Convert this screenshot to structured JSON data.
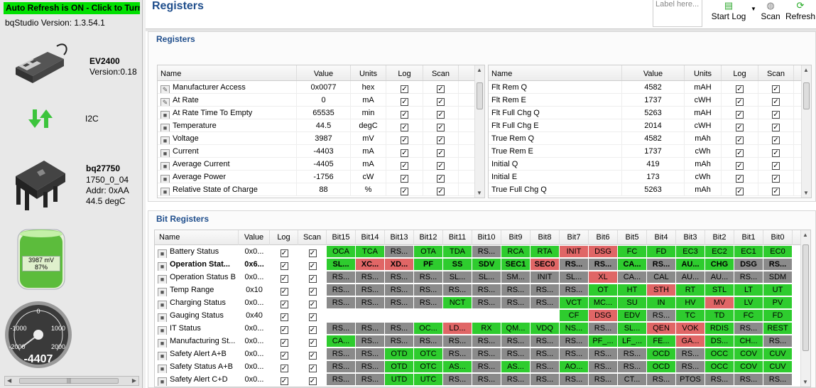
{
  "left_panel": {
    "refresh_banner": "Auto Refresh is ON - Click to Turn",
    "version": "bqStudio Version:  1.3.54.1",
    "adapter_name": "EV2400",
    "adapter_version": "Version:0.18",
    "bus": "I2C",
    "device_name": "bq27750",
    "device_fw": "1750_0_04",
    "device_addr": "Addr: 0xAA",
    "device_temp": "44.5 degC",
    "battery_mv": "3987 mV",
    "battery_pct": "87%",
    "battery_level": 0.87,
    "gauge_value": "-4407",
    "gauge_ticks": [
      "0",
      "-1000",
      "1000",
      "-2000",
      "2000"
    ]
  },
  "header": {
    "title": "Registers",
    "label_placeholder": "Label here...",
    "start_log": "Start Log",
    "scan": "Scan",
    "refresh": "Refresh"
  },
  "registers": {
    "title": "Registers",
    "columns": [
      "Name",
      "Value",
      "Units",
      "Log",
      "Scan"
    ],
    "left_rows": [
      {
        "name": "Manufacturer Access",
        "value": "0x0077",
        "units": "hex",
        "icon": "pencil"
      },
      {
        "name": "At Rate",
        "value": "0",
        "units": "mA",
        "icon": "pencil"
      },
      {
        "name": "At Rate Time To Empty",
        "value": "65535",
        "units": "min",
        "icon": "lock"
      },
      {
        "name": "Temperature",
        "value": "44.5",
        "units": "degC",
        "icon": "lock"
      },
      {
        "name": "Voltage",
        "value": "3987",
        "units": "mV",
        "icon": "lock"
      },
      {
        "name": "Current",
        "value": "-4403",
        "units": "mA",
        "icon": "lock"
      },
      {
        "name": "Average Current",
        "value": "-4405",
        "units": "mA",
        "icon": "lock"
      },
      {
        "name": "Average Power",
        "value": "-1756",
        "units": "cW",
        "icon": "lock"
      },
      {
        "name": "Relative State of Charge",
        "value": "88",
        "units": "%",
        "icon": "lock"
      }
    ],
    "right_rows": [
      {
        "name": "Flt Rem Q",
        "value": "4582",
        "units": "mAH"
      },
      {
        "name": "Flt Rem E",
        "value": "1737",
        "units": "cWH"
      },
      {
        "name": "Flt Full Chg Q",
        "value": "5263",
        "units": "mAH"
      },
      {
        "name": "Flt Full Chg E",
        "value": "2014",
        "units": "cWH"
      },
      {
        "name": "True Rem Q",
        "value": "4582",
        "units": "mAh"
      },
      {
        "name": "True Rem E",
        "value": "1737",
        "units": "cWh"
      },
      {
        "name": "Initial Q",
        "value": "419",
        "units": "mAh"
      },
      {
        "name": "Initial E",
        "value": "173",
        "units": "cWh"
      },
      {
        "name": "True Full Chg Q",
        "value": "5263",
        "units": "mAh"
      }
    ]
  },
  "bit_registers": {
    "title": "Bit Registers",
    "columns": [
      "Name",
      "Value",
      "Log",
      "Scan",
      "Bit15",
      "Bit14",
      "Bit13",
      "Bit12",
      "Bit11",
      "Bit10",
      "Bit9",
      "Bit8",
      "Bit7",
      "Bit6",
      "Bit5",
      "Bit4",
      "Bit3",
      "Bit2",
      "Bit1",
      "Bit0"
    ],
    "rows": [
      {
        "name": "Battery Status",
        "value": "0x0...",
        "bold": false,
        "bits": [
          [
            "OCA",
            "g"
          ],
          [
            "TCA",
            "g"
          ],
          [
            "RS...",
            "y"
          ],
          [
            "OTA",
            "g"
          ],
          [
            "TDA",
            "g"
          ],
          [
            "RS...",
            "y"
          ],
          [
            "RCA",
            "g"
          ],
          [
            "RTA",
            "g"
          ],
          [
            "INIT",
            "r"
          ],
          [
            "DSG",
            "r"
          ],
          [
            "FC",
            "g"
          ],
          [
            "FD",
            "g"
          ],
          [
            "EC3",
            "g"
          ],
          [
            "EC2",
            "g"
          ],
          [
            "EC1",
            "g"
          ],
          [
            "EC0",
            "g"
          ]
        ]
      },
      {
        "name": "Operation Stat...",
        "value": "0x6...",
        "bold": true,
        "bits": [
          [
            "SL...",
            "g"
          ],
          [
            "XC...",
            "r"
          ],
          [
            "XD...",
            "r"
          ],
          [
            "PF",
            "g"
          ],
          [
            "SS",
            "g"
          ],
          [
            "SDV",
            "g"
          ],
          [
            "SEC1",
            "g"
          ],
          [
            "SEC0",
            "r"
          ],
          [
            "RS...",
            "y"
          ],
          [
            "RS...",
            "y"
          ],
          [
            "CA...",
            "g"
          ],
          [
            "RS...",
            "y"
          ],
          [
            "AU...",
            "g"
          ],
          [
            "CHG",
            "g"
          ],
          [
            "DSG",
            "y"
          ],
          [
            "RS...",
            "y"
          ]
        ]
      },
      {
        "name": "Operation Status B",
        "value": "0x0...",
        "bold": false,
        "bits": [
          [
            "RS...",
            "y"
          ],
          [
            "RS...",
            "y"
          ],
          [
            "RS...",
            "y"
          ],
          [
            "RS...",
            "y"
          ],
          [
            "SL...",
            "y"
          ],
          [
            "SL...",
            "y"
          ],
          [
            "SM...",
            "y"
          ],
          [
            "INIT",
            "y"
          ],
          [
            "SL...",
            "y"
          ],
          [
            "XL",
            "r"
          ],
          [
            "CA...",
            "y"
          ],
          [
            "CAL",
            "y"
          ],
          [
            "AU...",
            "y"
          ],
          [
            "AU...",
            "y"
          ],
          [
            "RS...",
            "y"
          ],
          [
            "SDM",
            "y"
          ]
        ]
      },
      {
        "name": "Temp Range",
        "value": "0x10",
        "bold": false,
        "bits": [
          [
            "RS...",
            "y"
          ],
          [
            "RS...",
            "y"
          ],
          [
            "RS...",
            "y"
          ],
          [
            "RS...",
            "y"
          ],
          [
            "RS...",
            "y"
          ],
          [
            "RS...",
            "y"
          ],
          [
            "RS...",
            "y"
          ],
          [
            "RS...",
            "y"
          ],
          [
            "RS...",
            "y"
          ],
          [
            "OT",
            "g"
          ],
          [
            "HT",
            "g"
          ],
          [
            "STH",
            "r"
          ],
          [
            "RT",
            "g"
          ],
          [
            "STL",
            "g"
          ],
          [
            "LT",
            "g"
          ],
          [
            "UT",
            "g"
          ]
        ]
      },
      {
        "name": "Charging Status",
        "value": "0x0...",
        "bold": false,
        "bits": [
          [
            "RS...",
            "y"
          ],
          [
            "RS...",
            "y"
          ],
          [
            "RS...",
            "y"
          ],
          [
            "RS...",
            "y"
          ],
          [
            "NCT",
            "g"
          ],
          [
            "RS...",
            "y"
          ],
          [
            "RS...",
            "y"
          ],
          [
            "RS...",
            "y"
          ],
          [
            "VCT",
            "g"
          ],
          [
            "MC...",
            "g"
          ],
          [
            "SU",
            "g"
          ],
          [
            "IN",
            "g"
          ],
          [
            "HV",
            "g"
          ],
          [
            "MV",
            "r"
          ],
          [
            "LV",
            "g"
          ],
          [
            "PV",
            "g"
          ]
        ]
      },
      {
        "name": "Gauging Status",
        "value": "0x40",
        "bold": false,
        "bits": [
          [
            "",
            ""
          ],
          [
            "",
            ""
          ],
          [
            "",
            ""
          ],
          [
            "",
            ""
          ],
          [
            "",
            ""
          ],
          [
            "",
            ""
          ],
          [
            "",
            ""
          ],
          [
            "",
            ""
          ],
          [
            "CF",
            "g"
          ],
          [
            "DSG",
            "r"
          ],
          [
            "EDV",
            "g"
          ],
          [
            "RS...",
            "y"
          ],
          [
            "TC",
            "g"
          ],
          [
            "TD",
            "g"
          ],
          [
            "FC",
            "g"
          ],
          [
            "FD",
            "g"
          ]
        ]
      },
      {
        "name": "IT Status",
        "value": "0x0...",
        "bold": false,
        "bits": [
          [
            "RS...",
            "y"
          ],
          [
            "RS...",
            "y"
          ],
          [
            "RS...",
            "y"
          ],
          [
            "OC...",
            "g"
          ],
          [
            "LD...",
            "r"
          ],
          [
            "RX",
            "g"
          ],
          [
            "QM...",
            "g"
          ],
          [
            "VDQ",
            "g"
          ],
          [
            "NS...",
            "g"
          ],
          [
            "RS...",
            "y"
          ],
          [
            "SL...",
            "g"
          ],
          [
            "QEN",
            "r"
          ],
          [
            "VOK",
            "r"
          ],
          [
            "RDIS",
            "g"
          ],
          [
            "RS...",
            "y"
          ],
          [
            "REST",
            "g"
          ]
        ]
      },
      {
        "name": "Manufacturing St...",
        "value": "0x0...",
        "bold": false,
        "bits": [
          [
            "CA...",
            "g"
          ],
          [
            "RS...",
            "y"
          ],
          [
            "RS...",
            "y"
          ],
          [
            "RS...",
            "y"
          ],
          [
            "RS...",
            "y"
          ],
          [
            "RS...",
            "y"
          ],
          [
            "RS...",
            "y"
          ],
          [
            "RS...",
            "y"
          ],
          [
            "RS...",
            "y"
          ],
          [
            "PF_...",
            "g"
          ],
          [
            "LF_...",
            "g"
          ],
          [
            "FE...",
            "g"
          ],
          [
            "GA...",
            "r"
          ],
          [
            "DS...",
            "g"
          ],
          [
            "CH...",
            "g"
          ],
          [
            "RS...",
            "y"
          ]
        ]
      },
      {
        "name": "Safety Alert A+B",
        "value": "0x0...",
        "bold": false,
        "bits": [
          [
            "RS...",
            "y"
          ],
          [
            "RS...",
            "y"
          ],
          [
            "OTD",
            "g"
          ],
          [
            "OTC",
            "g"
          ],
          [
            "RS...",
            "y"
          ],
          [
            "RS...",
            "y"
          ],
          [
            "RS...",
            "y"
          ],
          [
            "RS...",
            "y"
          ],
          [
            "RS...",
            "y"
          ],
          [
            "RS...",
            "y"
          ],
          [
            "RS...",
            "y"
          ],
          [
            "OCD",
            "g"
          ],
          [
            "RS...",
            "y"
          ],
          [
            "OCC",
            "g"
          ],
          [
            "COV",
            "g"
          ],
          [
            "CUV",
            "g"
          ]
        ]
      },
      {
        "name": "Safety Status A+B",
        "value": "0x0...",
        "bold": false,
        "bits": [
          [
            "RS...",
            "y"
          ],
          [
            "RS...",
            "y"
          ],
          [
            "OTD",
            "g"
          ],
          [
            "OTC",
            "g"
          ],
          [
            "AS...",
            "g"
          ],
          [
            "RS...",
            "y"
          ],
          [
            "AS...",
            "g"
          ],
          [
            "RS...",
            "y"
          ],
          [
            "AO...",
            "g"
          ],
          [
            "RS...",
            "y"
          ],
          [
            "RS...",
            "y"
          ],
          [
            "OCD",
            "g"
          ],
          [
            "RS...",
            "y"
          ],
          [
            "OCC",
            "g"
          ],
          [
            "COV",
            "g"
          ],
          [
            "CUV",
            "g"
          ]
        ]
      },
      {
        "name": "Safety Alert C+D",
        "value": "0x0...",
        "bold": false,
        "bits": [
          [
            "RS...",
            "y"
          ],
          [
            "RS...",
            "y"
          ],
          [
            "UTD",
            "g"
          ],
          [
            "UTC",
            "g"
          ],
          [
            "RS...",
            "y"
          ],
          [
            "RS...",
            "y"
          ],
          [
            "RS...",
            "y"
          ],
          [
            "RS...",
            "y"
          ],
          [
            "RS...",
            "y"
          ],
          [
            "RS...",
            "y"
          ],
          [
            "CT...",
            "y"
          ],
          [
            "RS...",
            "y"
          ],
          [
            "PTOS",
            "y"
          ],
          [
            "RS...",
            "y"
          ],
          [
            "RS...",
            "y"
          ],
          [
            "RS...",
            "y"
          ]
        ]
      }
    ]
  }
}
